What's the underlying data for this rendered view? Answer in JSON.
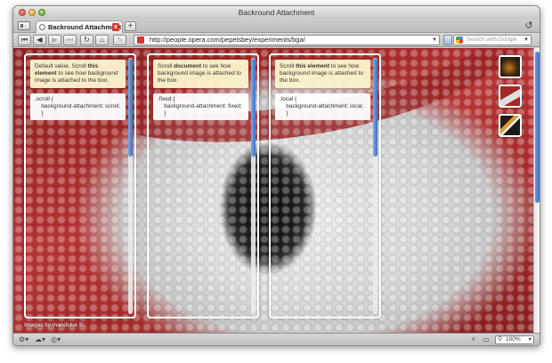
{
  "window": {
    "title": "Backround Attachment"
  },
  "tab": {
    "label": "Backround Attachment",
    "close_label": "x"
  },
  "toolbar": {
    "back_label": "◀",
    "forward_label": "▶",
    "rewind_label": "⏮",
    "fastforward_label": "⏭",
    "reload_label": "↻",
    "home_label": "⌂",
    "wand_label": "✎",
    "address": "http://people.opera.com/pepelsbey/experiments/bga/",
    "search_placeholder": "Search with Google"
  },
  "boxes": [
    {
      "note_pre": "Default value. Scroll ",
      "note_strong": "this element",
      "note_post": " to see how background image is attached to the box.",
      "code": ".scroll {\n    background-attachment: scroll;\n    }"
    },
    {
      "note_pre": "Scroll ",
      "note_strong": "document",
      "note_post": " to see how background image is attached to the box.",
      "code": ".fixed {\n    background-attachment: fixed;\n    }"
    },
    {
      "note_pre": "Scroll ",
      "note_strong": "this element",
      "note_post": " to see how background image is attached to the box.",
      "code": ".local {\n    background-attachment: local;\n    }"
    }
  ],
  "credit": "Images by mandolux ©",
  "statusbar": {
    "zoom": "100%"
  },
  "icons": {
    "panel_toggle": "panel-toggle-icon",
    "new_tab": "plus-icon",
    "trash": "trash-icon",
    "rss": "feed-icon",
    "google": "google-icon"
  }
}
